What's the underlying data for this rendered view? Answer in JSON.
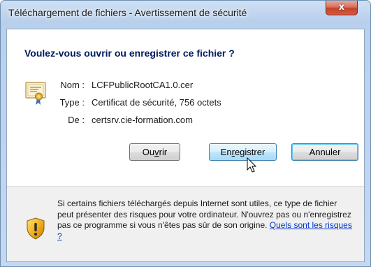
{
  "window": {
    "title": "Téléchargement de fichiers - Avertissement de sécurité",
    "close_glyph": "x"
  },
  "dialog": {
    "heading": "Voulez-vous ouvrir ou enregistrer ce fichier ?",
    "file_icon": "certificate-icon",
    "fields": {
      "name_label": "Nom :",
      "name_value": "LCFPublicRootCA1.0.cer",
      "type_label": "Type :",
      "type_value": "Certificat de sécurité, 756 octets",
      "from_label": "De :",
      "from_value": "certsrv.cie-formation.com"
    },
    "buttons": {
      "open_pre": "Ou",
      "open_accel": "v",
      "open_post": "rir",
      "save_pre": "En",
      "save_accel": "r",
      "save_post": "egistrer",
      "cancel": "Annuler"
    },
    "warning": {
      "icon": "shield-warning-icon",
      "text": "Si certains fichiers téléchargés depuis Internet sont utiles, ce type de fichier peut présenter des risques pour votre ordinateur. N'ouvrez pas ou n'enregistrez pas ce programme si vous n'êtes pas sûr de son origine.",
      "link": "Quels sont les risques ?"
    }
  },
  "colors": {
    "heading": "#001b5e",
    "link": "#0033cc",
    "close_button": "#c2432b",
    "hover_button": "#bee6fd"
  }
}
